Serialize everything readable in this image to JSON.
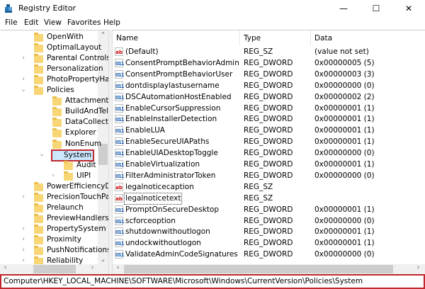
{
  "window": {
    "title": "Registry Editor",
    "minimize": "—",
    "maximize": "☐",
    "close": "✕"
  },
  "menu": [
    "File",
    "Edit",
    "View",
    "Favorites",
    "Help"
  ],
  "tree": [
    {
      "label": "OpenWith",
      "level": 1,
      "expander": ""
    },
    {
      "label": "OptimalLayout",
      "level": 1,
      "expander": ""
    },
    {
      "label": "Parental Controls",
      "level": 1,
      "expander": ">"
    },
    {
      "label": "Personalization",
      "level": 1,
      "expander": ""
    },
    {
      "label": "PhotoPropertyHar",
      "level": 1,
      "expander": ">"
    },
    {
      "label": "Policies",
      "level": 1,
      "expander": "v"
    },
    {
      "label": "Attachments",
      "level": 2,
      "expander": ""
    },
    {
      "label": "BuildAndTel",
      "level": 2,
      "expander": ""
    },
    {
      "label": "DataCollection",
      "level": 2,
      "expander": ""
    },
    {
      "label": "Explorer",
      "level": 2,
      "expander": ""
    },
    {
      "label": "NonEnum",
      "level": 2,
      "expander": ""
    },
    {
      "label": "System",
      "level": 2,
      "expander": "v",
      "selected": true
    },
    {
      "label": "Audit",
      "level": 3,
      "expander": ""
    },
    {
      "label": "UIPI",
      "level": 3,
      "expander": ">"
    },
    {
      "label": "PowerEfficiencyDi",
      "level": 1,
      "expander": ""
    },
    {
      "label": "PrecisionTouchPa",
      "level": 1,
      "expander": ">"
    },
    {
      "label": "Prelaunch",
      "level": 1,
      "expander": ""
    },
    {
      "label": "PreviewHandlers",
      "level": 1,
      "expander": ""
    },
    {
      "label": "PropertySystem",
      "level": 1,
      "expander": ">"
    },
    {
      "label": "Proximity",
      "level": 1,
      "expander": ">"
    },
    {
      "label": "PushNotifications",
      "level": 1,
      "expander": ">"
    },
    {
      "label": "Reliability",
      "level": 1,
      "expander": ">"
    }
  ],
  "columns": {
    "name": "Name",
    "type": "Type",
    "data": "Data"
  },
  "values": [
    {
      "name": "(Default)",
      "type": "REG_SZ",
      "data": "(value not set)",
      "icon": "ab"
    },
    {
      "name": "ConsentPromptBehaviorAdmin",
      "type": "REG_DWORD",
      "data": "0x00000005 (5)",
      "icon": "dw"
    },
    {
      "name": "ConsentPromptBehaviorUser",
      "type": "REG_DWORD",
      "data": "0x00000003 (3)",
      "icon": "dw"
    },
    {
      "name": "dontdisplaylastusername",
      "type": "REG_DWORD",
      "data": "0x00000000 (0)",
      "icon": "dw"
    },
    {
      "name": "DSCAutomationHostEnabled",
      "type": "REG_DWORD",
      "data": "0x00000002 (2)",
      "icon": "dw"
    },
    {
      "name": "EnableCursorSuppression",
      "type": "REG_DWORD",
      "data": "0x00000001 (1)",
      "icon": "dw"
    },
    {
      "name": "EnableInstallerDetection",
      "type": "REG_DWORD",
      "data": "0x00000001 (1)",
      "icon": "dw"
    },
    {
      "name": "EnableLUA",
      "type": "REG_DWORD",
      "data": "0x00000001 (1)",
      "icon": "dw"
    },
    {
      "name": "EnableSecureUIAPaths",
      "type": "REG_DWORD",
      "data": "0x00000001 (1)",
      "icon": "dw"
    },
    {
      "name": "EnableUIADesktopToggle",
      "type": "REG_DWORD",
      "data": "0x00000000 (0)",
      "icon": "dw"
    },
    {
      "name": "EnableVirtualization",
      "type": "REG_DWORD",
      "data": "0x00000001 (1)",
      "icon": "dw"
    },
    {
      "name": "FilterAdministratorToken",
      "type": "REG_DWORD",
      "data": "0x00000000 (0)",
      "icon": "dw"
    },
    {
      "name": "legalnoticecaption",
      "type": "REG_SZ",
      "data": "",
      "icon": "ab"
    },
    {
      "name": "legalnoticetext",
      "type": "REG_SZ",
      "data": "",
      "icon": "ab",
      "focused": true
    },
    {
      "name": "PromptOnSecureDesktop",
      "type": "REG_DWORD",
      "data": "0x00000001 (1)",
      "icon": "dw"
    },
    {
      "name": "scforceoption",
      "type": "REG_DWORD",
      "data": "0x00000000 (0)",
      "icon": "dw"
    },
    {
      "name": "shutdownwithoutlogon",
      "type": "REG_DWORD",
      "data": "0x00000001 (1)",
      "icon": "dw"
    },
    {
      "name": "undockwithoutlogon",
      "type": "REG_DWORD",
      "data": "0x00000001 (1)",
      "icon": "dw"
    },
    {
      "name": "ValidateAdminCodeSignatures",
      "type": "REG_DWORD",
      "data": "0x00000000 (0)",
      "icon": "dw"
    }
  ],
  "icon_text": {
    "ab": "ab",
    "dw": "011"
  },
  "status": {
    "path": "Computer\\HKEY_LOCAL_MACHINE\\SOFTWARE\\Microsoft\\Windows\\CurrentVersion\\Policies\\System"
  },
  "colors": {
    "highlight": "#c0272d",
    "folder": "#f8d675"
  }
}
